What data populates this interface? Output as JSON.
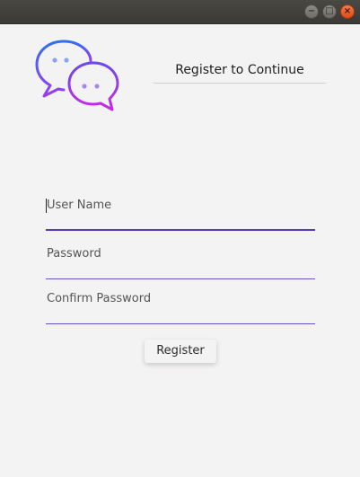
{
  "window": {
    "controls": {
      "minimize_icon": "minimize-icon",
      "maximize_icon": "maximize-icon",
      "close_icon": "close-icon"
    }
  },
  "header": {
    "logo_icon": "chat-bubbles-icon",
    "title": "Register to Continue"
  },
  "form": {
    "username": {
      "placeholder": "User Name",
      "value": ""
    },
    "password": {
      "placeholder": "Password",
      "value": ""
    },
    "confirm_password": {
      "placeholder": "Confirm Password",
      "value": ""
    },
    "register_label": "Register"
  },
  "colors": {
    "accent": "#6a4fc1",
    "logo_gradient_start": "#2f6ff2",
    "logo_gradient_end": "#c02ce0",
    "close_button": "#e95420"
  }
}
